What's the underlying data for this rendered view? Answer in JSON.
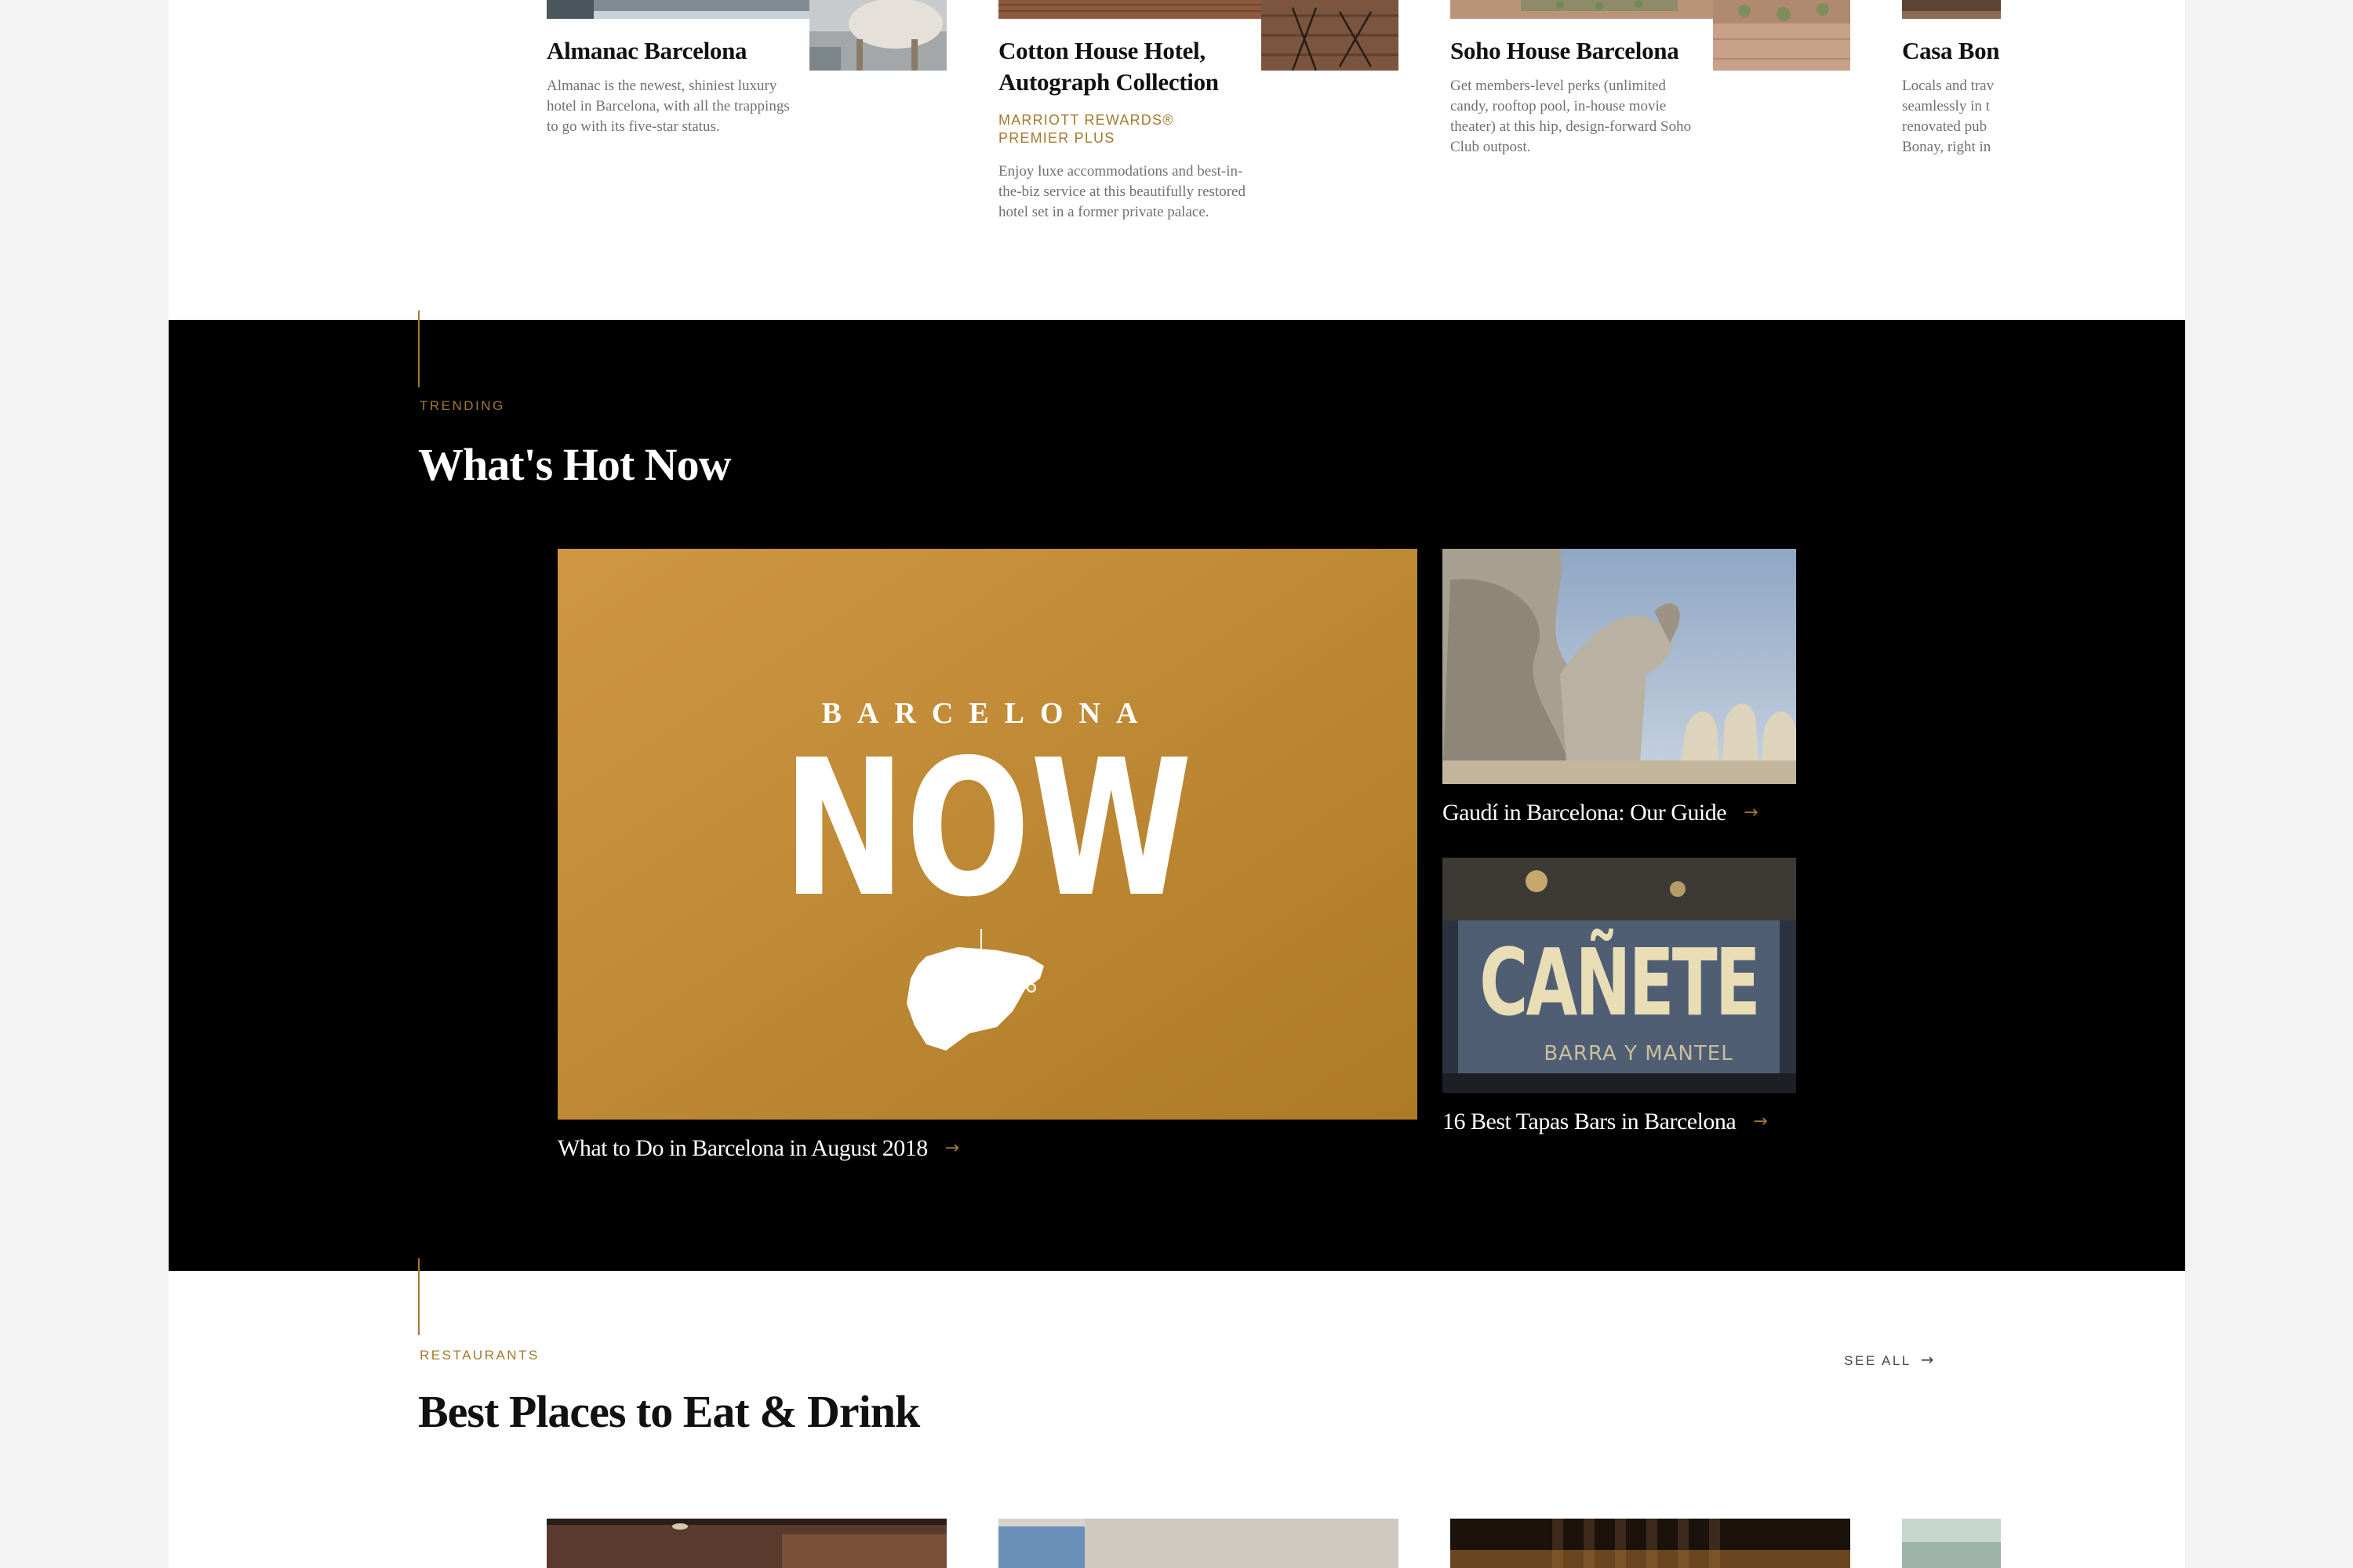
{
  "hotels": [
    {
      "name": "Almanac Barcelona",
      "badge": "",
      "description": "Almanac is the newest, shiniest luxury hotel in Barcelona, with all the trappings to go with its five-star status."
    },
    {
      "name": "Cotton House Hotel, Autograph Collection",
      "badge": "MARRIOTT REWARDS® PREMIER PLUS",
      "description": "Enjoy luxe accommodations and best-in-the-biz service at this beautifully restored hotel set in a former private palace."
    },
    {
      "name": "Soho House Barcelona",
      "badge": "",
      "description": "Get members-level perks (unlimited candy, rooftop pool, in-house movie theater) at this hip, design-forward Soho Club outpost."
    },
    {
      "name": "Casa Bon",
      "badge": "",
      "description": "Locals and trav seamlessly in t renovated pub Bonay, right in"
    }
  ],
  "trending": {
    "eyebrow": "TRENDING",
    "title": "What's Hot Now",
    "feature": {
      "brand_top": "BARCELONA",
      "brand_main": "NOW",
      "caption": "What to Do in Barcelona in August 2018",
      "arrow_icon": "arrow-right-icon",
      "background": "#b8842c"
    },
    "side": [
      {
        "caption": "Gaudí in Barcelona: Our Guide",
        "arrow_icon": "arrow-right-icon"
      },
      {
        "caption": "16 Best Tapas Bars in Barcelona",
        "sign_text": "CAÑETE",
        "sign_sub": "BARRA Y MANTEL",
        "arrow_icon": "arrow-right-icon"
      }
    ]
  },
  "restaurants": {
    "eyebrow": "RESTAURANTS",
    "title": "Best Places to Eat & Drink",
    "see_all": "SEE ALL"
  },
  "colors": {
    "accent_gold": "#a27a2c",
    "black": "#000000",
    "page_bg": "#f3f3f3"
  }
}
